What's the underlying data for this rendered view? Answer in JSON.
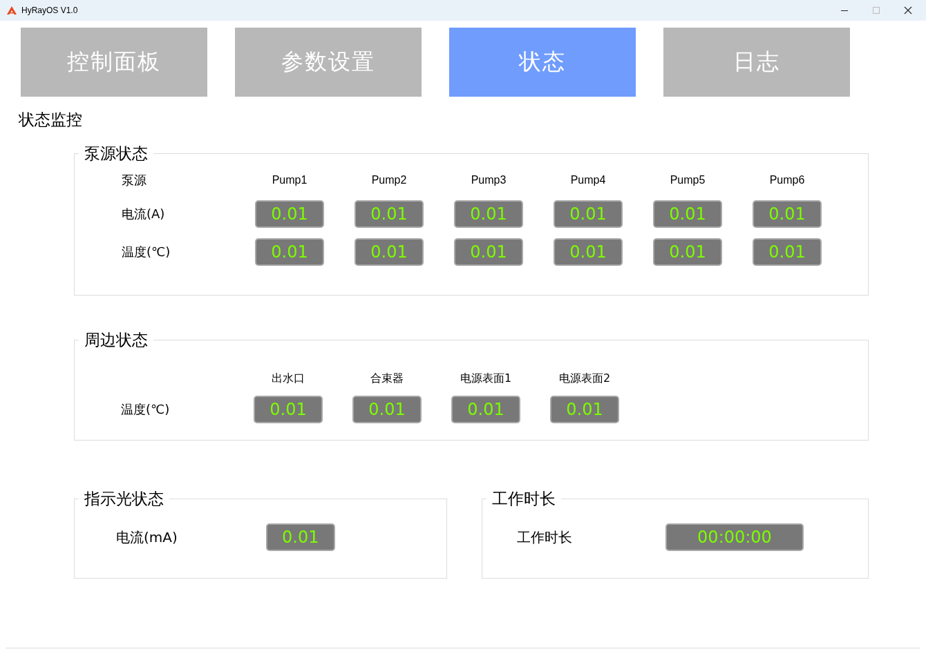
{
  "window": {
    "title": "HyRayOS V1.0"
  },
  "tabs": [
    {
      "label": "控制面板",
      "selected": false
    },
    {
      "label": "参数设置",
      "selected": false
    },
    {
      "label": "状态",
      "selected": true
    },
    {
      "label": "日志",
      "selected": false
    }
  ],
  "page_title": "状态监控",
  "pump_group": {
    "title": "泵源状态",
    "header_label": "泵源",
    "columns": [
      "Pump1",
      "Pump2",
      "Pump3",
      "Pump4",
      "Pump5",
      "Pump6"
    ],
    "rows": [
      {
        "label": "电流(A)",
        "values": [
          "0.01",
          "0.01",
          "0.01",
          "0.01",
          "0.01",
          "0.01"
        ]
      },
      {
        "label": "温度(℃)",
        "values": [
          "0.01",
          "0.01",
          "0.01",
          "0.01",
          "0.01",
          "0.01"
        ]
      }
    ]
  },
  "peripheral_group": {
    "title": "周边状态",
    "columns": [
      "出水口",
      "合束器",
      "电源表面1",
      "电源表面2"
    ],
    "rows": [
      {
        "label": "温度(℃)",
        "values": [
          "0.01",
          "0.01",
          "0.01",
          "0.01"
        ]
      }
    ]
  },
  "indicator_group": {
    "title": "指示光状态",
    "label": "电流(mA)",
    "value": "0.01"
  },
  "runtime_group": {
    "title": "工作时长",
    "label": "工作时长",
    "value": "00:00:00"
  }
}
